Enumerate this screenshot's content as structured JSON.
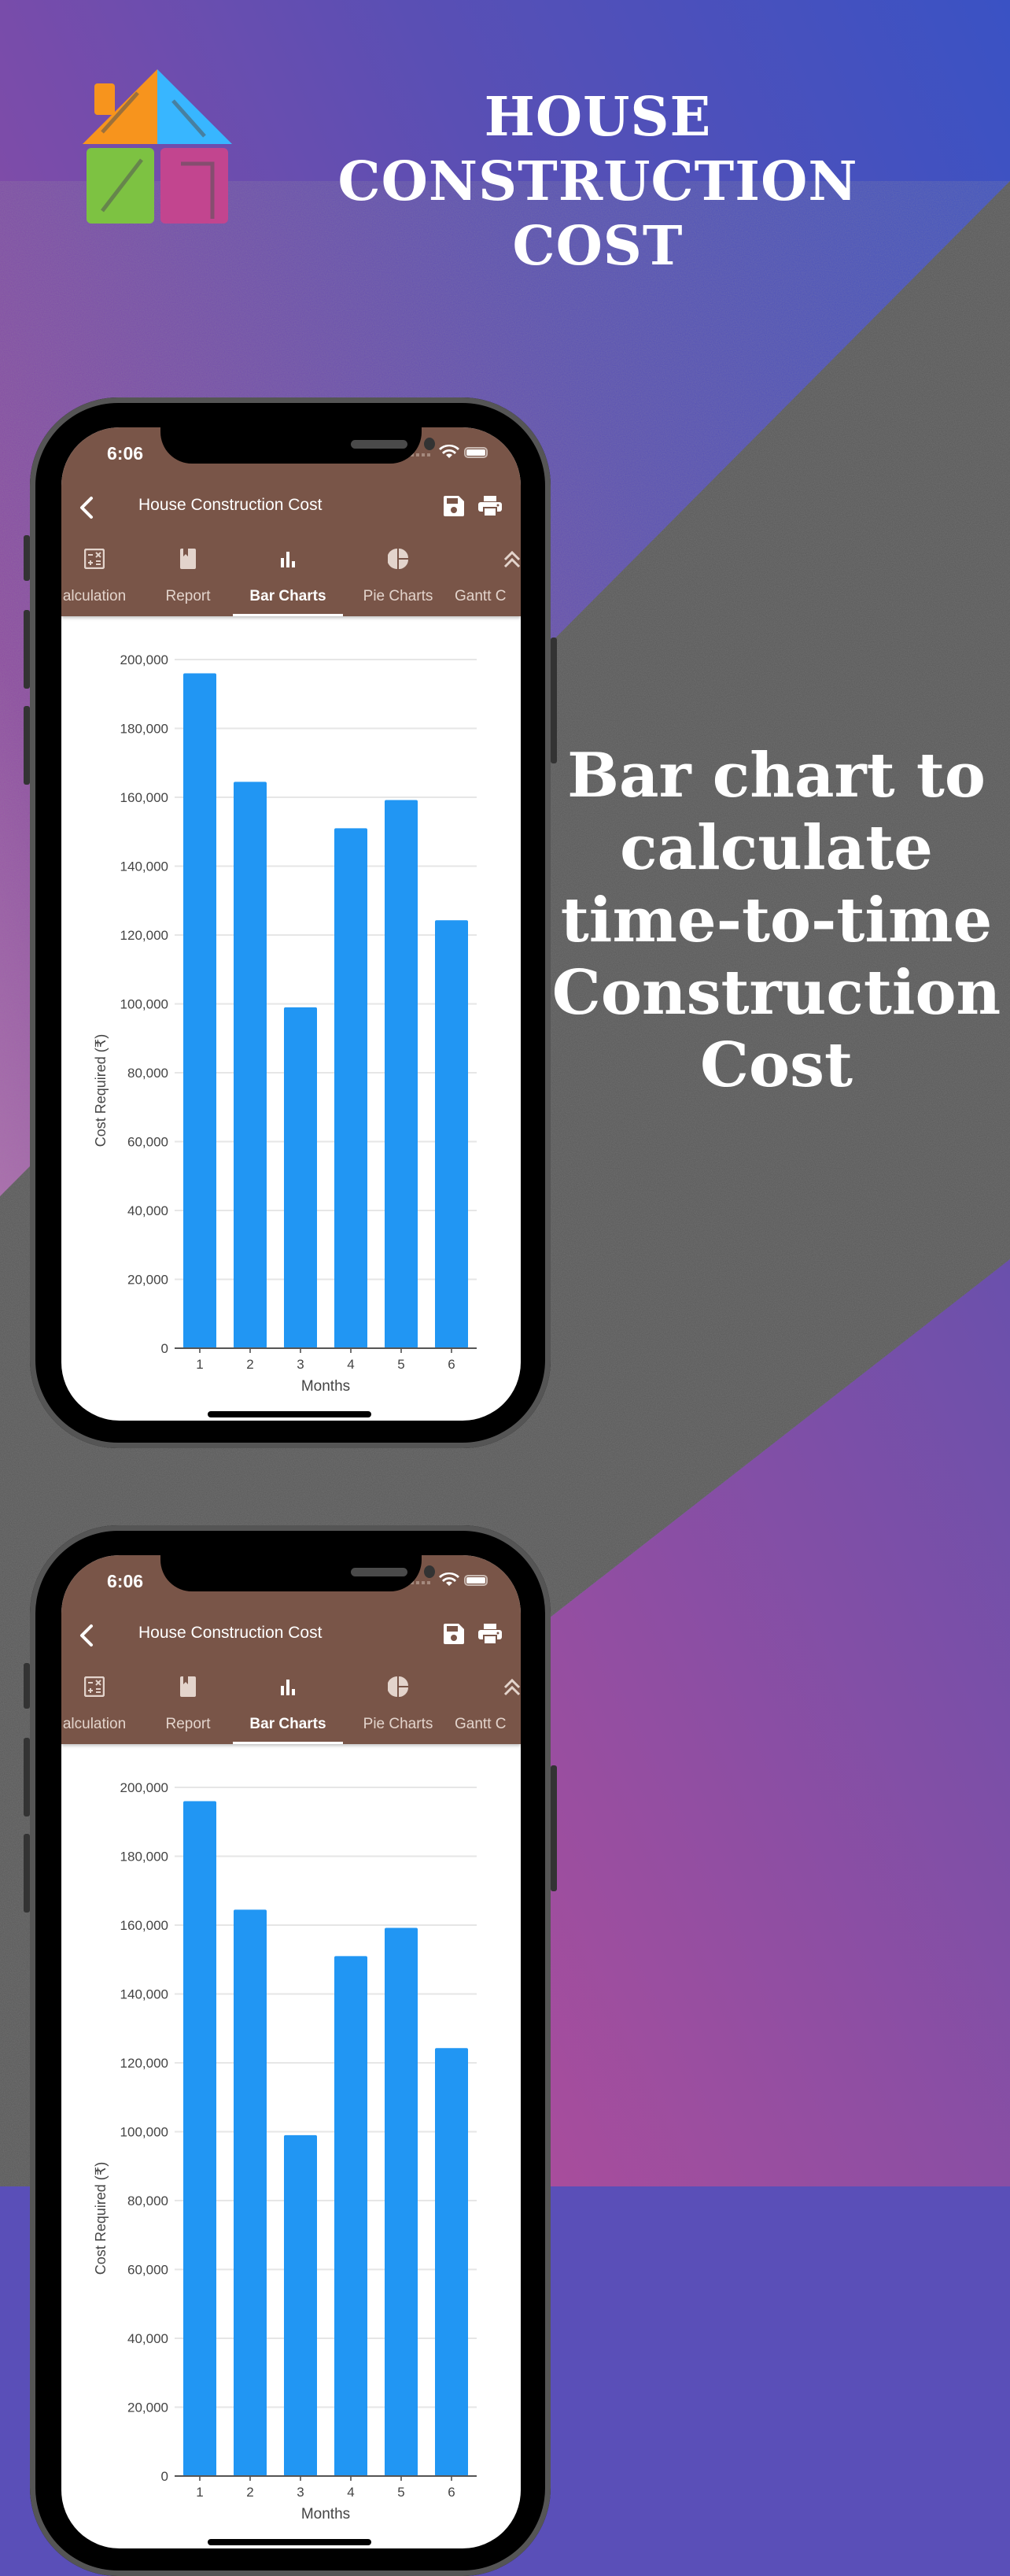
{
  "banner": {
    "title_line1": "HOUSE CONSTRUCTION",
    "title_line2": "COST",
    "tagline_lines": [
      "Bar chart to",
      "calculate",
      "time-to-time",
      "Construction",
      "Cost"
    ]
  },
  "colors": {
    "appbar": "#795548",
    "bar": "#2196F3",
    "grid": "#e6e6e6",
    "axis_text": "#444444"
  },
  "phones": [
    {
      "status_time": "6:06",
      "title": "House Construction Cost",
      "icons": {
        "back": "chevron-left-icon",
        "save": "save-icon",
        "print": "print-icon"
      },
      "tabs": [
        {
          "label": "Calculation",
          "shown": "alculation",
          "icon": "calculator-icon",
          "active": false
        },
        {
          "label": "Report",
          "icon": "bookmark-book-icon",
          "active": false
        },
        {
          "label": "Bar Charts",
          "icon": "bar-chart-icon",
          "active": true
        },
        {
          "label": "Pie Charts",
          "icon": "pie-chart-icon",
          "active": false
        },
        {
          "label": "Gantt Chart",
          "shown": "Gantt C",
          "icon": "double-chevron-up-icon",
          "active": false
        }
      ]
    },
    {
      "status_time": "6:06",
      "title": "House Construction Cost",
      "icons": {
        "back": "chevron-left-icon",
        "save": "save-icon",
        "print": "print-icon"
      },
      "tabs": [
        {
          "label": "Calculation",
          "shown": "alculation",
          "icon": "calculator-icon",
          "active": false
        },
        {
          "label": "Report",
          "icon": "bookmark-book-icon",
          "active": false
        },
        {
          "label": "Bar Charts",
          "icon": "bar-chart-icon",
          "active": true
        },
        {
          "label": "Pie Charts",
          "icon": "pie-chart-icon",
          "active": false
        },
        {
          "label": "Gantt Chart",
          "shown": "Gantt C",
          "icon": "double-chevron-up-icon",
          "active": false
        }
      ]
    }
  ],
  "chart_data": [
    {
      "type": "bar",
      "title": "",
      "xlabel": "Months",
      "ylabel": "Cost Required (₹)",
      "categories": [
        "1",
        "2",
        "3",
        "4",
        "5",
        "6"
      ],
      "values": [
        196000,
        164500,
        99000,
        151000,
        159200,
        124300
      ],
      "ylim": [
        0,
        200000
      ],
      "yticks": [
        0,
        20000,
        40000,
        60000,
        80000,
        100000,
        120000,
        140000,
        160000,
        180000,
        200000
      ],
      "ytick_labels": [
        "0",
        "20,000",
        "40,000",
        "60,000",
        "80,000",
        "100,000",
        "120,000",
        "140,000",
        "160,000",
        "180,000",
        "200,000"
      ],
      "grid": true,
      "legend": "none"
    },
    {
      "type": "bar",
      "title": "",
      "xlabel": "Months",
      "ylabel": "Cost Required (₹)",
      "categories": [
        "1",
        "2",
        "3",
        "4",
        "5",
        "6"
      ],
      "values": [
        196000,
        164500,
        99000,
        151000,
        159200,
        124300
      ],
      "ylim": [
        0,
        200000
      ],
      "yticks": [
        0,
        20000,
        40000,
        60000,
        80000,
        100000,
        120000,
        140000,
        160000,
        180000,
        200000
      ],
      "ytick_labels": [
        "0",
        "20,000",
        "40,000",
        "60,000",
        "80,000",
        "100,000",
        "120,000",
        "140,000",
        "160,000",
        "180,000",
        "200,000"
      ],
      "grid": true,
      "legend": "none"
    }
  ]
}
